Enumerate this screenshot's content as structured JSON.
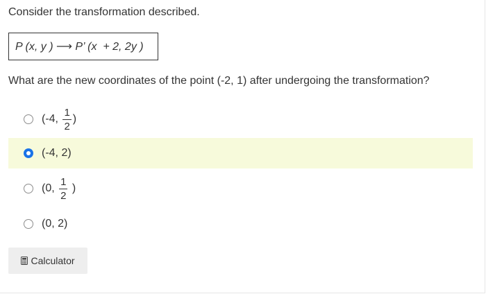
{
  "prompt": {
    "intro": "Consider the transformation described.",
    "formula": "P (x, y ) ⟶ P’ (x  + 2, 2y )",
    "question": "What are the new coordinates of the point (-2, 1) after undergoing the transformation?"
  },
  "options": [
    {
      "prefix": "(-4, ",
      "frac_num": "1",
      "frac_den": "2",
      "suffix": ")",
      "selected": false
    },
    {
      "text": "(-4, 2)",
      "selected": true
    },
    {
      "prefix": "(0, ",
      "frac_num": "1",
      "frac_den": "2",
      "suffix": " )",
      "selected": false
    },
    {
      "text": "(0, 2)",
      "selected": false
    }
  ],
  "toolbar": {
    "calculator_label": "Calculator",
    "calculator_icon": "calculator-icon"
  },
  "colors": {
    "selected_bg": "#f7fadb",
    "radio_checked": "#1a73e8",
    "button_bg": "#eeeeee"
  }
}
